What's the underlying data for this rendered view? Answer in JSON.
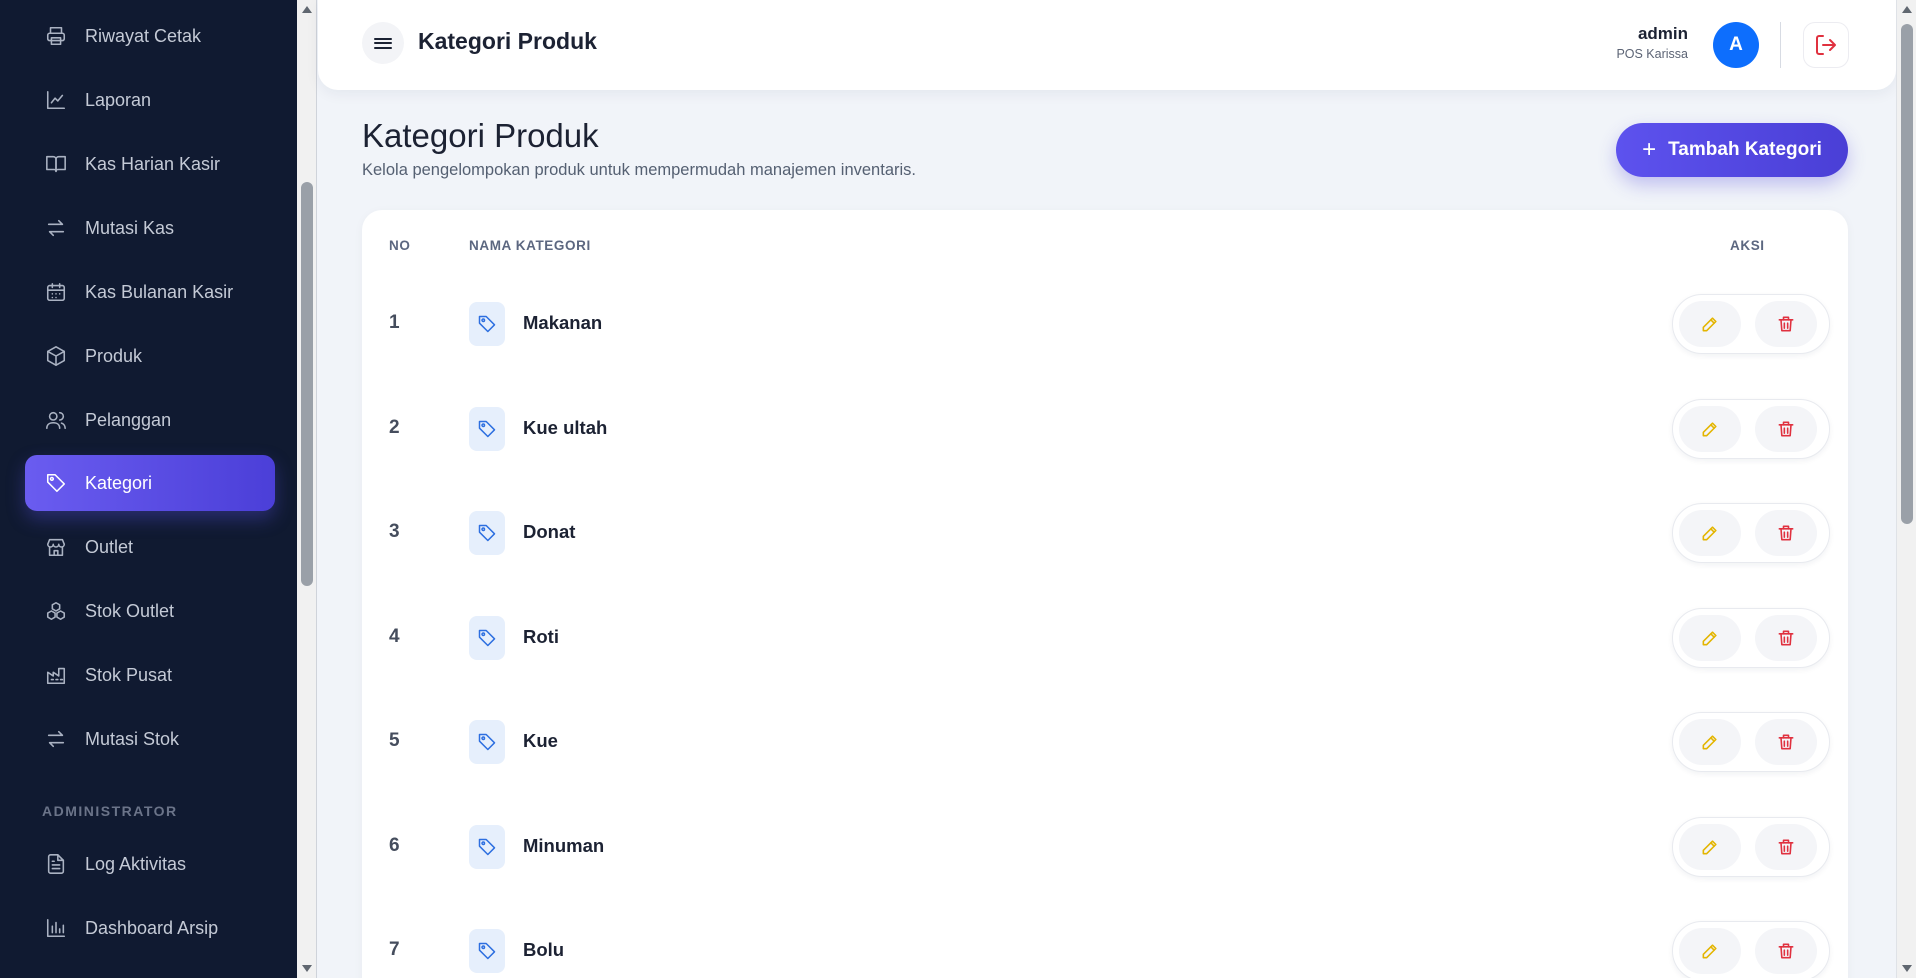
{
  "header": {
    "title": "Kategori Produk",
    "user_name": "admin",
    "user_role": "POS Karissa",
    "avatar_initial": "A"
  },
  "sidebar": {
    "items": [
      {
        "label": "Riwayat Cetak",
        "icon": "printer-icon"
      },
      {
        "label": "Laporan",
        "icon": "line-chart-icon"
      },
      {
        "label": "Kas Harian Kasir",
        "icon": "book-icon"
      },
      {
        "label": "Mutasi Kas",
        "icon": "arrows-swap-icon"
      },
      {
        "label": "Kas Bulanan Kasir",
        "icon": "calendar-icon"
      },
      {
        "label": "Produk",
        "icon": "box-icon"
      },
      {
        "label": "Pelanggan",
        "icon": "users-icon"
      },
      {
        "label": "Kategori",
        "icon": "tag-icon",
        "active": true
      },
      {
        "label": "Outlet",
        "icon": "store-icon"
      },
      {
        "label": "Stok Outlet",
        "icon": "boxes-icon"
      },
      {
        "label": "Stok Pusat",
        "icon": "factory-icon"
      },
      {
        "label": "Mutasi Stok",
        "icon": "arrows-swap-icon"
      }
    ],
    "section_label": "ADMINISTRATOR",
    "admin_items": [
      {
        "label": "Log Aktivitas",
        "icon": "file-text-icon"
      },
      {
        "label": "Dashboard Arsip",
        "icon": "bar-chart-icon"
      }
    ]
  },
  "page": {
    "title": "Kategori Produk",
    "subtitle": "Kelola pengelompokan produk untuk mempermudah manajemen inventaris.",
    "add_button": "Tambah Kategori"
  },
  "table": {
    "columns": [
      "NO",
      "NAMA KATEGORI",
      "AKSI"
    ],
    "rows": [
      {
        "no": "1",
        "name": "Makanan"
      },
      {
        "no": "2",
        "name": "Kue ultah"
      },
      {
        "no": "3",
        "name": "Donat"
      },
      {
        "no": "4",
        "name": "Roti"
      },
      {
        "no": "5",
        "name": "Kue"
      },
      {
        "no": "6",
        "name": "Minuman"
      },
      {
        "no": "7",
        "name": "Bolu"
      }
    ]
  },
  "colors": {
    "sidebar_bg": "#101a31",
    "accent": "#5d52ee",
    "avatar": "#0d6efd",
    "edit": "#e3b500",
    "delete": "#e0313f",
    "tag": "#2d6fe0"
  }
}
